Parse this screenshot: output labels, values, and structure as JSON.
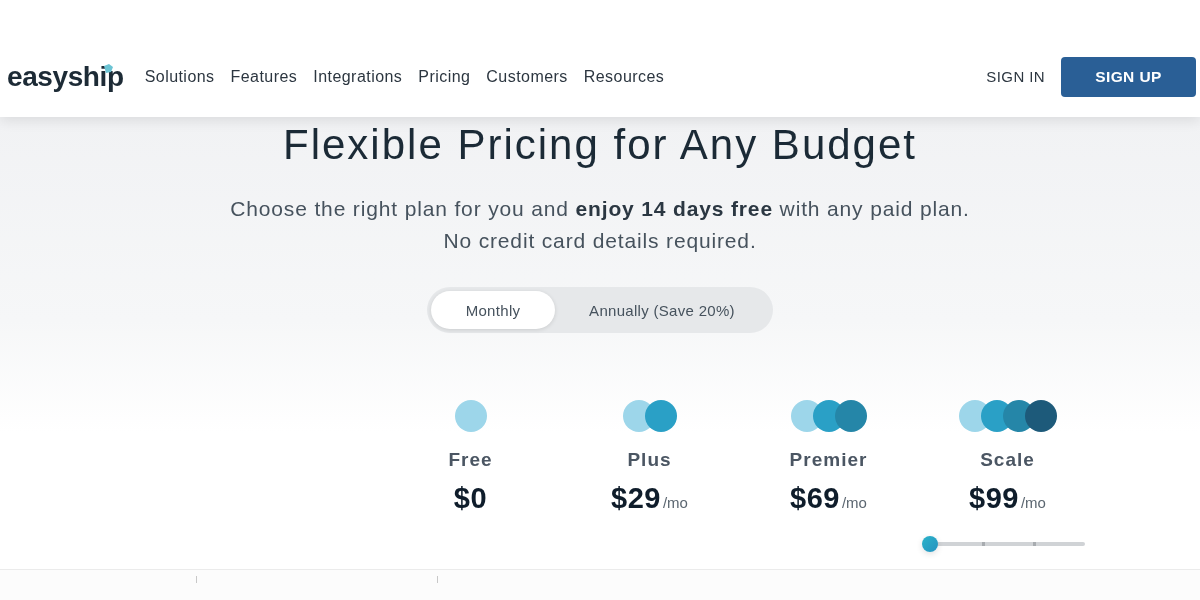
{
  "header": {
    "logo": "easyship",
    "nav": [
      "Solutions",
      "Features",
      "Integrations",
      "Pricing",
      "Customers",
      "Resources"
    ],
    "sign_in": "SIGN IN",
    "sign_up": "SIGN UP"
  },
  "hero": {
    "title": "Flexible Pricing for Any Budget",
    "subtitle_lines": [
      "Choose the right plan for you and **enjoy 14 days free** with any paid plan.",
      "No credit card details required."
    ]
  },
  "billing_toggle": [
    {
      "label": "Monthly",
      "selected": true
    },
    {
      "label": "Annually (Save 20%)",
      "selected": false
    }
  ],
  "plans": [
    {
      "name": "Free",
      "price": "$0",
      "dots": [
        {
          "color": "#9dd6ea"
        }
      ]
    },
    {
      "name": "Plus",
      "price": "$29",
      "period": "/mo",
      "dots": [
        {
          "color": "#9dd6ea"
        },
        {
          "color": "#2aa0c6"
        }
      ]
    },
    {
      "name": "Premier",
      "price": "$69",
      "period": "/mo",
      "dots": [
        {
          "color": "#9dd6ea"
        },
        {
          "color": "#2aa0c6"
        },
        {
          "color": "#2586a8"
        }
      ]
    },
    {
      "name": "Scale",
      "price": "$99",
      "period": "/mo",
      "dots": [
        {
          "color": "#9dd6ea"
        },
        {
          "color": "#2aa0c6"
        },
        {
          "color": "#2586a8"
        },
        {
          "color": "#1d5a7a"
        }
      ]
    }
  ],
  "volume_slider": {
    "level": 0
  }
}
